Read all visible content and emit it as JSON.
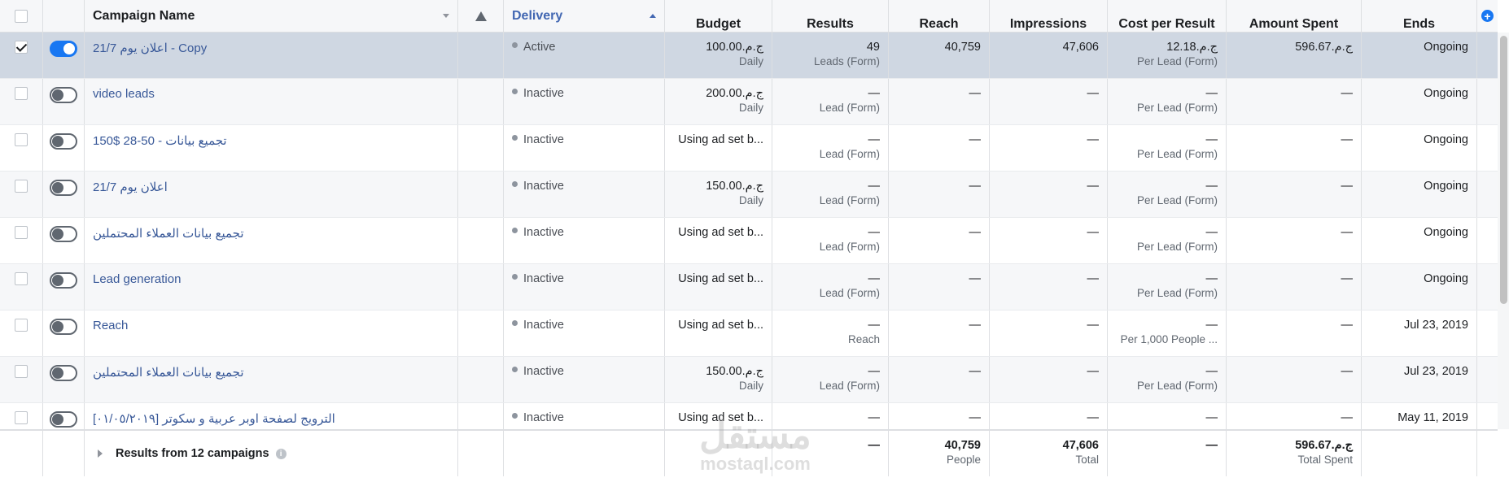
{
  "columns": {
    "name": "Campaign Name",
    "delivery": "Delivery",
    "budget": "Budget",
    "results": "Results",
    "reach": "Reach",
    "impressions": "Impressions",
    "cost_per_result": "Cost per Result",
    "amount_spent": "Amount Spent",
    "ends": "Ends"
  },
  "rows": [
    {
      "name": "21/7 اعلان يوم - Copy",
      "on": true,
      "checked": true,
      "status": "Active",
      "budget": "ج.م.100.00",
      "budget_sub": "Daily",
      "results": "49",
      "results_sub": "Leads (Form)",
      "reach": "40,759",
      "impressions": "47,606",
      "cpr": "ج.م.12.18",
      "cpr_sub": "Per Lead (Form)",
      "spent": "ج.م.596.67",
      "ends": "Ongoing"
    },
    {
      "name": "video leads",
      "on": false,
      "checked": false,
      "status": "Inactive",
      "budget": "ج.م.200.00",
      "budget_sub": "Daily",
      "results": "—",
      "results_sub": "Lead (Form)",
      "reach": "—",
      "impressions": "—",
      "cpr": "—",
      "cpr_sub": "Per Lead (Form)",
      "spent": "—",
      "ends": "Ongoing"
    },
    {
      "name": "تجميع بيانات - 50-28 $150",
      "on": false,
      "checked": false,
      "status": "Inactive",
      "budget": "Using ad set b...",
      "budget_sub": "",
      "results": "—",
      "results_sub": "Lead (Form)",
      "reach": "—",
      "impressions": "—",
      "cpr": "—",
      "cpr_sub": "Per Lead (Form)",
      "spent": "—",
      "ends": "Ongoing"
    },
    {
      "name": "اعلان يوم 21/7",
      "on": false,
      "checked": false,
      "status": "Inactive",
      "budget": "ج.م.150.00",
      "budget_sub": "Daily",
      "results": "—",
      "results_sub": "Lead (Form)",
      "reach": "—",
      "impressions": "—",
      "cpr": "—",
      "cpr_sub": "Per Lead (Form)",
      "spent": "—",
      "ends": "Ongoing"
    },
    {
      "name": "تجميع بيانات العملاء المحتملين",
      "on": false,
      "checked": false,
      "status": "Inactive",
      "budget": "Using ad set b...",
      "budget_sub": "",
      "results": "—",
      "results_sub": "Lead (Form)",
      "reach": "—",
      "impressions": "—",
      "cpr": "—",
      "cpr_sub": "Per Lead (Form)",
      "spent": "—",
      "ends": "Ongoing"
    },
    {
      "name": "Lead generation",
      "on": false,
      "checked": false,
      "status": "Inactive",
      "budget": "Using ad set b...",
      "budget_sub": "",
      "results": "—",
      "results_sub": "Lead (Form)",
      "reach": "—",
      "impressions": "—",
      "cpr": "—",
      "cpr_sub": "Per Lead (Form)",
      "spent": "—",
      "ends": "Ongoing"
    },
    {
      "name": "Reach",
      "on": false,
      "checked": false,
      "status": "Inactive",
      "budget": "Using ad set b...",
      "budget_sub": "",
      "results": "—",
      "results_sub": "Reach",
      "reach": "—",
      "impressions": "—",
      "cpr": "—",
      "cpr_sub": "Per 1,000 People ...",
      "spent": "—",
      "ends": "Jul 23, 2019"
    },
    {
      "name": "تجميع بيانات العملاء المحتملين",
      "on": false,
      "checked": false,
      "status": "Inactive",
      "budget": "ج.م.150.00",
      "budget_sub": "Daily",
      "results": "—",
      "results_sub": "Lead (Form)",
      "reach": "—",
      "impressions": "—",
      "cpr": "—",
      "cpr_sub": "Per Lead (Form)",
      "spent": "—",
      "ends": "Jul 23, 2019"
    },
    {
      "name": "[٠١/٠٥/٢٠١٩] الترويج لصفحة اوبر عربية و سكوتر",
      "on": false,
      "checked": false,
      "status": "Inactive",
      "budget": "Using ad set b...",
      "budget_sub": "",
      "results": "—",
      "results_sub": "",
      "reach": "—",
      "impressions": "—",
      "cpr": "—",
      "cpr_sub": "",
      "spent": "—",
      "ends": "May 11, 2019"
    }
  ],
  "footer": {
    "label": "Results from 12 campaigns",
    "results": "—",
    "reach": "40,759",
    "reach_sub": "People",
    "impressions": "47,606",
    "impressions_sub": "Total",
    "cpr": "—",
    "spent": "ج.م.596.67",
    "spent_sub": "Total Spent"
  },
  "watermark": {
    "arabic": "مستقل",
    "latin": "mostaql.com"
  },
  "colors": {
    "link": "#385898",
    "accent": "#1877f2",
    "selected_row": "#cfd7e2",
    "alt_row": "#f6f7f9"
  }
}
